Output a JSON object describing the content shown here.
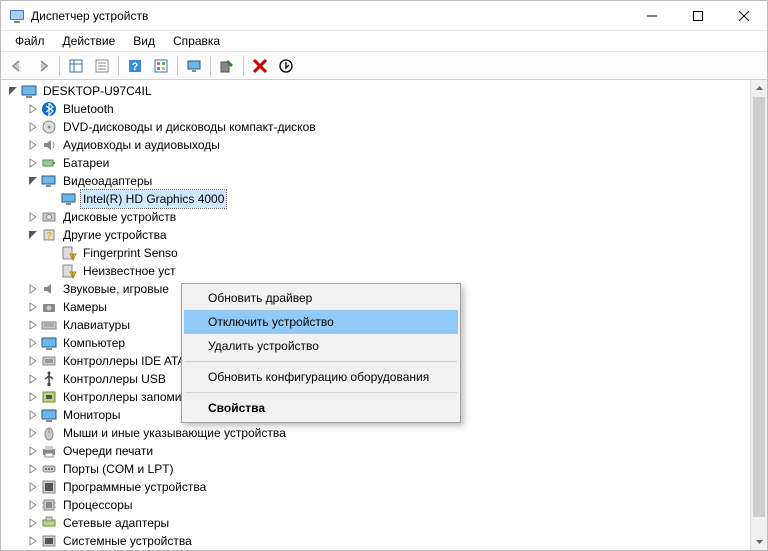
{
  "window": {
    "title": "Диспетчер устройств"
  },
  "menu": {
    "file": "Файл",
    "action": "Действие",
    "view": "Вид",
    "help": "Справка"
  },
  "root": "DESKTOP-U97C4IL",
  "cat": {
    "bluetooth": "Bluetooth",
    "dvd": "DVD-дисководы и дисководы компакт-дисков",
    "audio": "Аудиовходы и аудиовыходы",
    "battery": "Батареи",
    "video": "Видеоадаптеры",
    "video_item": "Intel(R) HD Graphics 4000",
    "disk": "Дисковые устройств",
    "other": "Другие устройства",
    "other_fp": "Fingerprint Senso",
    "other_unk": "Неизвестное уст",
    "sound": "Звуковые, игровые",
    "camera": "Камеры",
    "keyboard": "Клавиатуры",
    "computer": "Компьютер",
    "ide": "Контроллеры IDE ATA/ATAPI",
    "usb": "Контроллеры USB",
    "storage": "Контроллеры запоминающих устройств",
    "monitor": "Мониторы",
    "mouse": "Мыши и иные указывающие устройства",
    "printq": "Очереди печати",
    "ports": "Порты (COM и LPT)",
    "software": "Программные устройства",
    "cpu": "Процессоры",
    "net": "Сетевые адаптеры",
    "system": "Системные устройства"
  },
  "ctx": {
    "update": "Обновить драйвер",
    "disable": "Отключить устройство",
    "uninstall": "Удалить устройство",
    "scan": "Обновить конфигурацию оборудования",
    "props": "Свойства"
  }
}
